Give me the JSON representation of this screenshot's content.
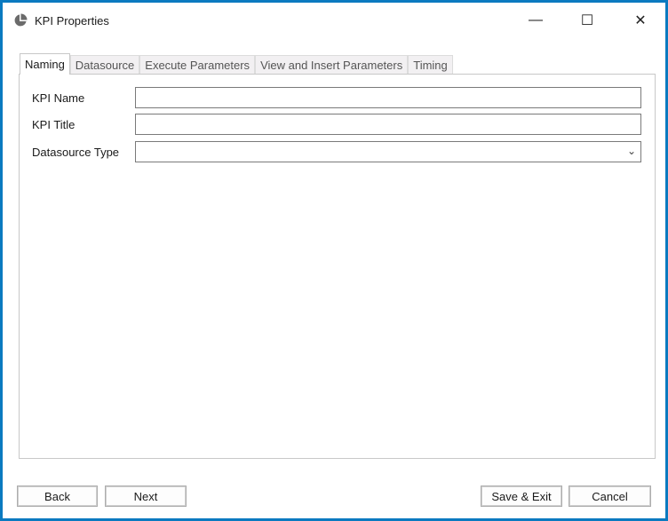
{
  "window": {
    "title": "KPI Properties",
    "icon": "pie-chart-icon",
    "accent": "#0b7ac0"
  },
  "controls": {
    "minimize": "—",
    "maximize": "☐",
    "close": "✕"
  },
  "tabs": [
    {
      "label": "Naming",
      "active": true
    },
    {
      "label": "Datasource"
    },
    {
      "label": "Execute Parameters"
    },
    {
      "label": "View and Insert Parameters"
    },
    {
      "label": "Timing"
    }
  ],
  "form": {
    "kpi_name": {
      "label": "KPI Name",
      "value": ""
    },
    "kpi_title": {
      "label": "KPI Title",
      "value": ""
    },
    "datasource_type": {
      "label": "Datasource Type",
      "value": ""
    }
  },
  "buttons": {
    "back": "Back",
    "next": "Next",
    "save_exit": "Save & Exit",
    "cancel": "Cancel"
  }
}
